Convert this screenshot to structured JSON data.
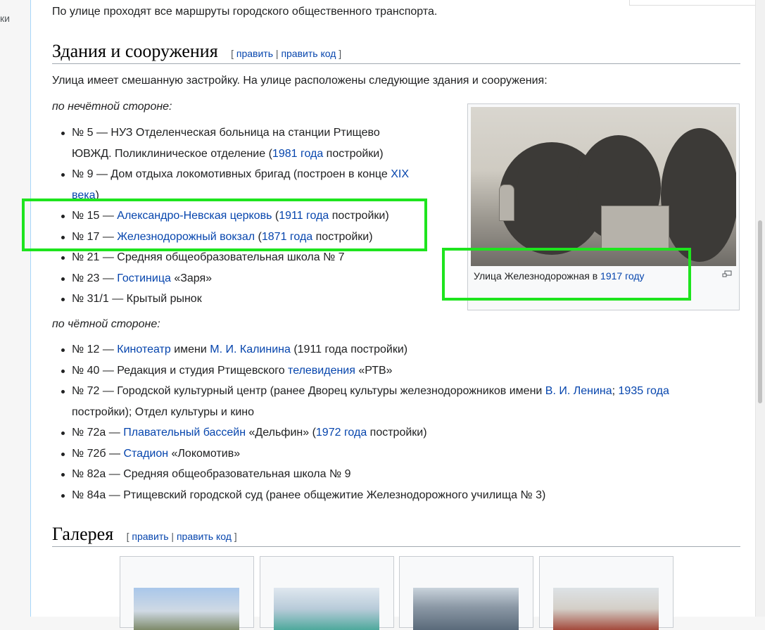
{
  "sidebar": {
    "cut_text": "ки"
  },
  "intro_text": "По улице проходят все маршруты городского общественного транспорта.",
  "section_buildings": {
    "title": "Здания и сооружения",
    "edit_open": "[",
    "edit_label": "править",
    "edit_sep": "|",
    "edit_code_label": "править код",
    "edit_close": "]",
    "description": "Улица имеет смешанную застройку. На улице расположены следующие здания и сооружения:",
    "odd_side_label": "по нечётной стороне:",
    "even_side_label": "по чётной стороне:"
  },
  "odd_items": [
    {
      "lines": [
        "№ 5 — НУЗ Отделенческая больница на станции Ртищево",
        "ЮВЖД. Поликлиническое отделение (",
        "1981 года",
        " постройки)"
      ]
    },
    {
      "a": "№ 9 — Дом отдыха локомотивных бригад (построен в конце ",
      "link": "XIX",
      "b": "века",
      "c": ")"
    },
    {
      "a": "№ 15 — ",
      "link1": "Александро-Невская церковь",
      "b": " (",
      "link2": "1911 года",
      "c": " постройки)"
    },
    {
      "a": "№ 17 — ",
      "link1": "Железнодорожный вокзал",
      "b": " (",
      "link2": "1871 года",
      "c": " постройки)"
    },
    {
      "a": "№ 21 — Средняя общеобразовательная школа № 7"
    },
    {
      "a": "№ 23 — ",
      "link1": "Гостиница",
      "b": " «Заря»"
    },
    {
      "a": "№ 31/1 — Крытый рынок"
    }
  ],
  "even_items": [
    {
      "a": "№ 12 — ",
      "link1": "Кинотеатр",
      "b": " имени ",
      "link2": "М. И. Калинина",
      "c": " (1911 года постройки)"
    },
    {
      "a": "№ 40 — Редакция и студия Ртищевского ",
      "link1": "телевидения",
      "b": " «РТВ»"
    },
    {
      "a": "№ 72 — Городской культурный центр (ранее Дворец культуры железнодорожников имени ",
      "link1": "В. И. Ленина",
      "b": "; ",
      "link2": "1935 года",
      "c": "постройки); Отдел культуры и кино"
    },
    {
      "a": "№ 72а — ",
      "link1": "Плавательный бассейн",
      "b": " «Дельфин» (",
      "link2": "1972 года",
      "c": " постройки)"
    },
    {
      "a": "№ 72б — ",
      "link1": "Стадион",
      "b": " «Локомотив»"
    },
    {
      "a": "№ 82а — Средняя общеобразовательная школа № 9"
    },
    {
      "a": "№ 84а — Ртищевский городской суд (ранее общежитие Железнодорожного училища № 3)"
    }
  ],
  "thumbnail": {
    "caption_text": "Улица Железнодорожная в ",
    "caption_link": "1917 году"
  },
  "section_gallery": {
    "title": "Галерея",
    "edit_open": "[",
    "edit_label": "править",
    "edit_sep": "|",
    "edit_code_label": "править код",
    "edit_close": "]"
  },
  "colors": {
    "link": "#0645ad",
    "highlight": "#1ee41e",
    "text": "#202122"
  }
}
